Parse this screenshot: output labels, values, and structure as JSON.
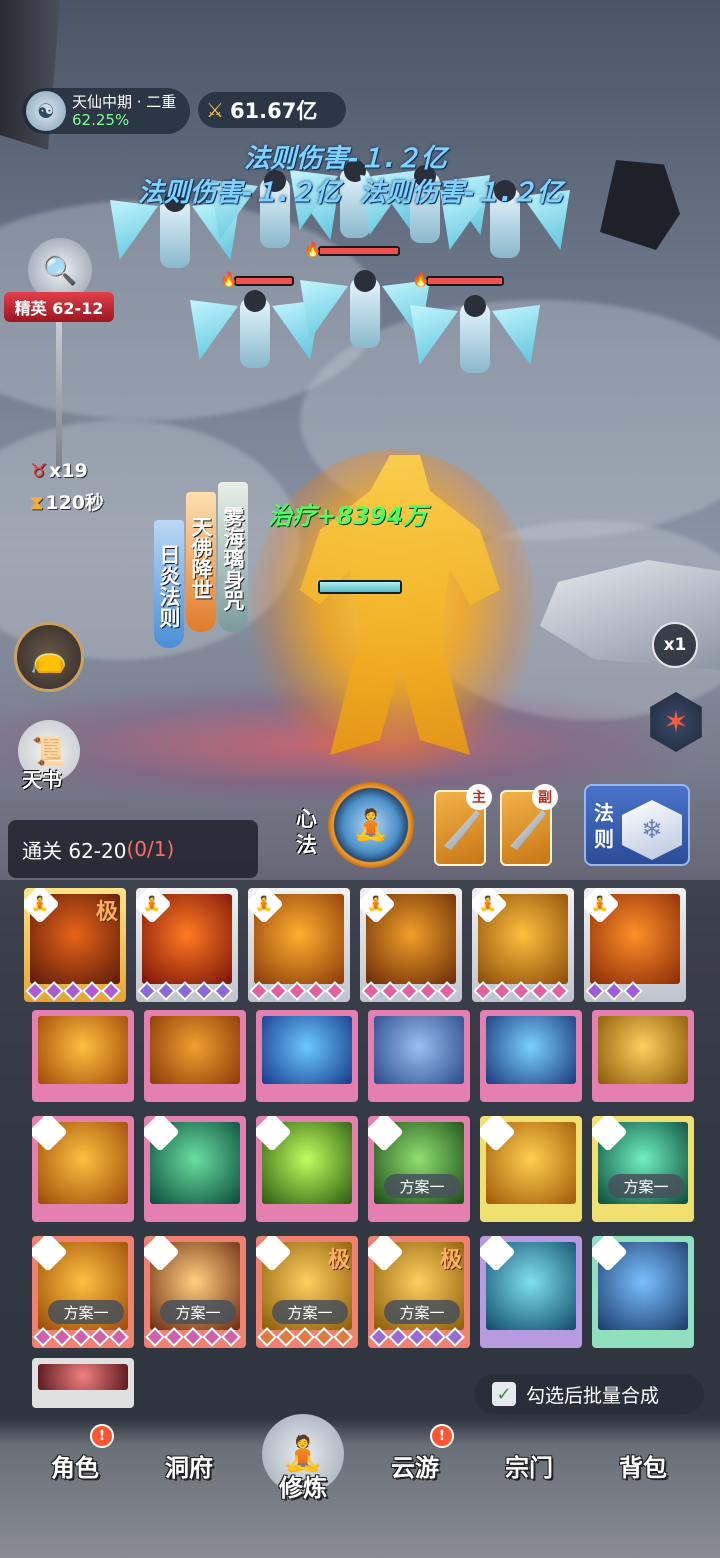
{
  "hud": {
    "realm_name": "天仙中期 · 二重",
    "realm_progress": "62.25%",
    "combat_power": "61.67亿",
    "stage_tag": "精英 62-12",
    "monster_count": "x19",
    "time_left": "120秒"
  },
  "battle_text": {
    "damage_1": "法则伤害-１.２亿",
    "damage_2": "法则伤害-１.２亿",
    "damage_3": "法则伤害-１.２亿",
    "heal": "治疗+8394万"
  },
  "banners": [
    {
      "label": "日炎法则",
      "color": "#4a8ed8"
    },
    {
      "label": "天佛降世",
      "color": "#e07a2a"
    },
    {
      "label": "雾海璃身咒",
      "color": "#7a9a9a"
    }
  ],
  "side_buttons": {
    "book_label": "天书",
    "speed_label": "x1"
  },
  "clear_bar": {
    "label": "通关 62-20",
    "progress": "(0/1)"
  },
  "equip": {
    "xinfa_label": "心法",
    "main_tag": "主",
    "sub_tag": "副",
    "fa_label": "法则"
  },
  "equipped_skills": [
    {
      "icon": "meditation-icon",
      "art": [
        "#e8641a",
        "#5a1a08"
      ],
      "ji": "极",
      "gems": 5,
      "gem_color": "#b05ad0"
    },
    {
      "icon": "meditation-icon",
      "art": [
        "#ff7a22",
        "#7a1208"
      ],
      "ji": "",
      "gems": 5,
      "gem_color": "#8a6ad8"
    },
    {
      "icon": "meditation-icon",
      "art": [
        "#ffb030",
        "#8a3a08"
      ],
      "ji": "",
      "gems": 5,
      "gem_color": "#e060a0"
    },
    {
      "icon": "meditation-icon",
      "art": [
        "#f0a028",
        "#6a2a08"
      ],
      "ji": "",
      "gems": 5,
      "gem_color": "#e060a0"
    },
    {
      "icon": "meditation-icon",
      "art": [
        "#ffc040",
        "#8a4a08"
      ],
      "ji": "",
      "gems": 5,
      "gem_color": "#e060a0"
    },
    {
      "icon": "meditation-icon",
      "art": [
        "#ff9028",
        "#8a2a08"
      ],
      "ji": "",
      "gems": 3,
      "gem_color": "#a05ae0"
    }
  ],
  "inventory_row1": [
    {
      "art": [
        "#ffc040",
        "#a04a08"
      ],
      "frame": "#e57fb0"
    },
    {
      "art": [
        "#f0a030",
        "#8a3a08"
      ],
      "frame": "#e57fb0"
    },
    {
      "art": [
        "#6ac8ff",
        "#183a8a"
      ],
      "frame": "#e57fb0"
    },
    {
      "art": [
        "#9ac0f0",
        "#2a4a8a"
      ],
      "frame": "#e57fb0"
    },
    {
      "art": [
        "#7ad0ff",
        "#1a3a7a"
      ],
      "frame": "#e57fb0"
    },
    {
      "art": [
        "#ffd060",
        "#8a5a08"
      ],
      "frame": "#e57fb0"
    }
  ],
  "inventory_row2": [
    {
      "icon": "sword-icon",
      "art": [
        "#ffc040",
        "#9a4a08"
      ],
      "frame": "#e57fb0",
      "plan": ""
    },
    {
      "icon": "sword-icon",
      "art": [
        "#6ae0a0",
        "#0a4a3a"
      ],
      "frame": "#e57fb0",
      "plan": ""
    },
    {
      "icon": "sword-icon",
      "art": [
        "#c0ff60",
        "#2a5a10"
      ],
      "frame": "#e57fb0",
      "plan": ""
    },
    {
      "icon": "sword-icon",
      "art": [
        "#90e070",
        "#1a4a18"
      ],
      "frame": "#e57fb0",
      "plan": "方案一"
    },
    {
      "icon": "sword-icon",
      "art": [
        "#ffd050",
        "#a05808"
      ],
      "frame": "#f0e070",
      "plan": ""
    },
    {
      "icon": "sword-icon",
      "art": [
        "#70f0c0",
        "#0a4a3a"
      ],
      "frame": "#f0e070",
      "plan": "方案一"
    }
  ],
  "inventory_row3": [
    {
      "icon": "sword-icon",
      "art": [
        "#ffc040",
        "#9a4a08"
      ],
      "frame": "#f08070",
      "plan": "方案一",
      "ji": "",
      "gems": 5,
      "gem_color": "#d060a8"
    },
    {
      "icon": "sword-icon",
      "art": [
        "#ffd080",
        "#6a2a10"
      ],
      "frame": "#f08070",
      "plan": "方案一",
      "ji": "",
      "gems": 5,
      "gem_color": "#d060a8"
    },
    {
      "icon": "sword-icon",
      "art": [
        "#ffd060",
        "#8a5a08"
      ],
      "frame": "#f08070",
      "plan": "方案一",
      "ji": "极",
      "gems": 5,
      "gem_color": "#e07a40"
    },
    {
      "icon": "sword-icon",
      "art": [
        "#ffd060",
        "#8a5a08"
      ],
      "frame": "#f08070",
      "plan": "方案一",
      "ji": "极",
      "gems": 5,
      "gem_color": "#9a6ad0"
    },
    {
      "icon": "sword-icon",
      "art": [
        "#80e0f0",
        "#104a6a"
      ],
      "frame": "#b89ae0",
      "plan": "",
      "ji": "",
      "gems": 0,
      "gem_color": ""
    },
    {
      "icon": "sword-icon",
      "art": [
        "#7ac0ff",
        "#1a3a6a"
      ],
      "frame": "#90e0c0",
      "plan": "",
      "ji": "",
      "gems": 0,
      "gem_color": ""
    }
  ],
  "inventory_row4": [
    {
      "art": [
        "#f08080",
        "#5a1a20"
      ],
      "frame": "#e0e0e0"
    }
  ],
  "batch": {
    "label": "勾选后批量合成"
  },
  "nav": {
    "items": [
      "角色",
      "洞府",
      "修炼",
      "云游",
      "宗门",
      "背包"
    ],
    "badges": [
      "!",
      "",
      "",
      "!",
      "",
      ""
    ]
  }
}
